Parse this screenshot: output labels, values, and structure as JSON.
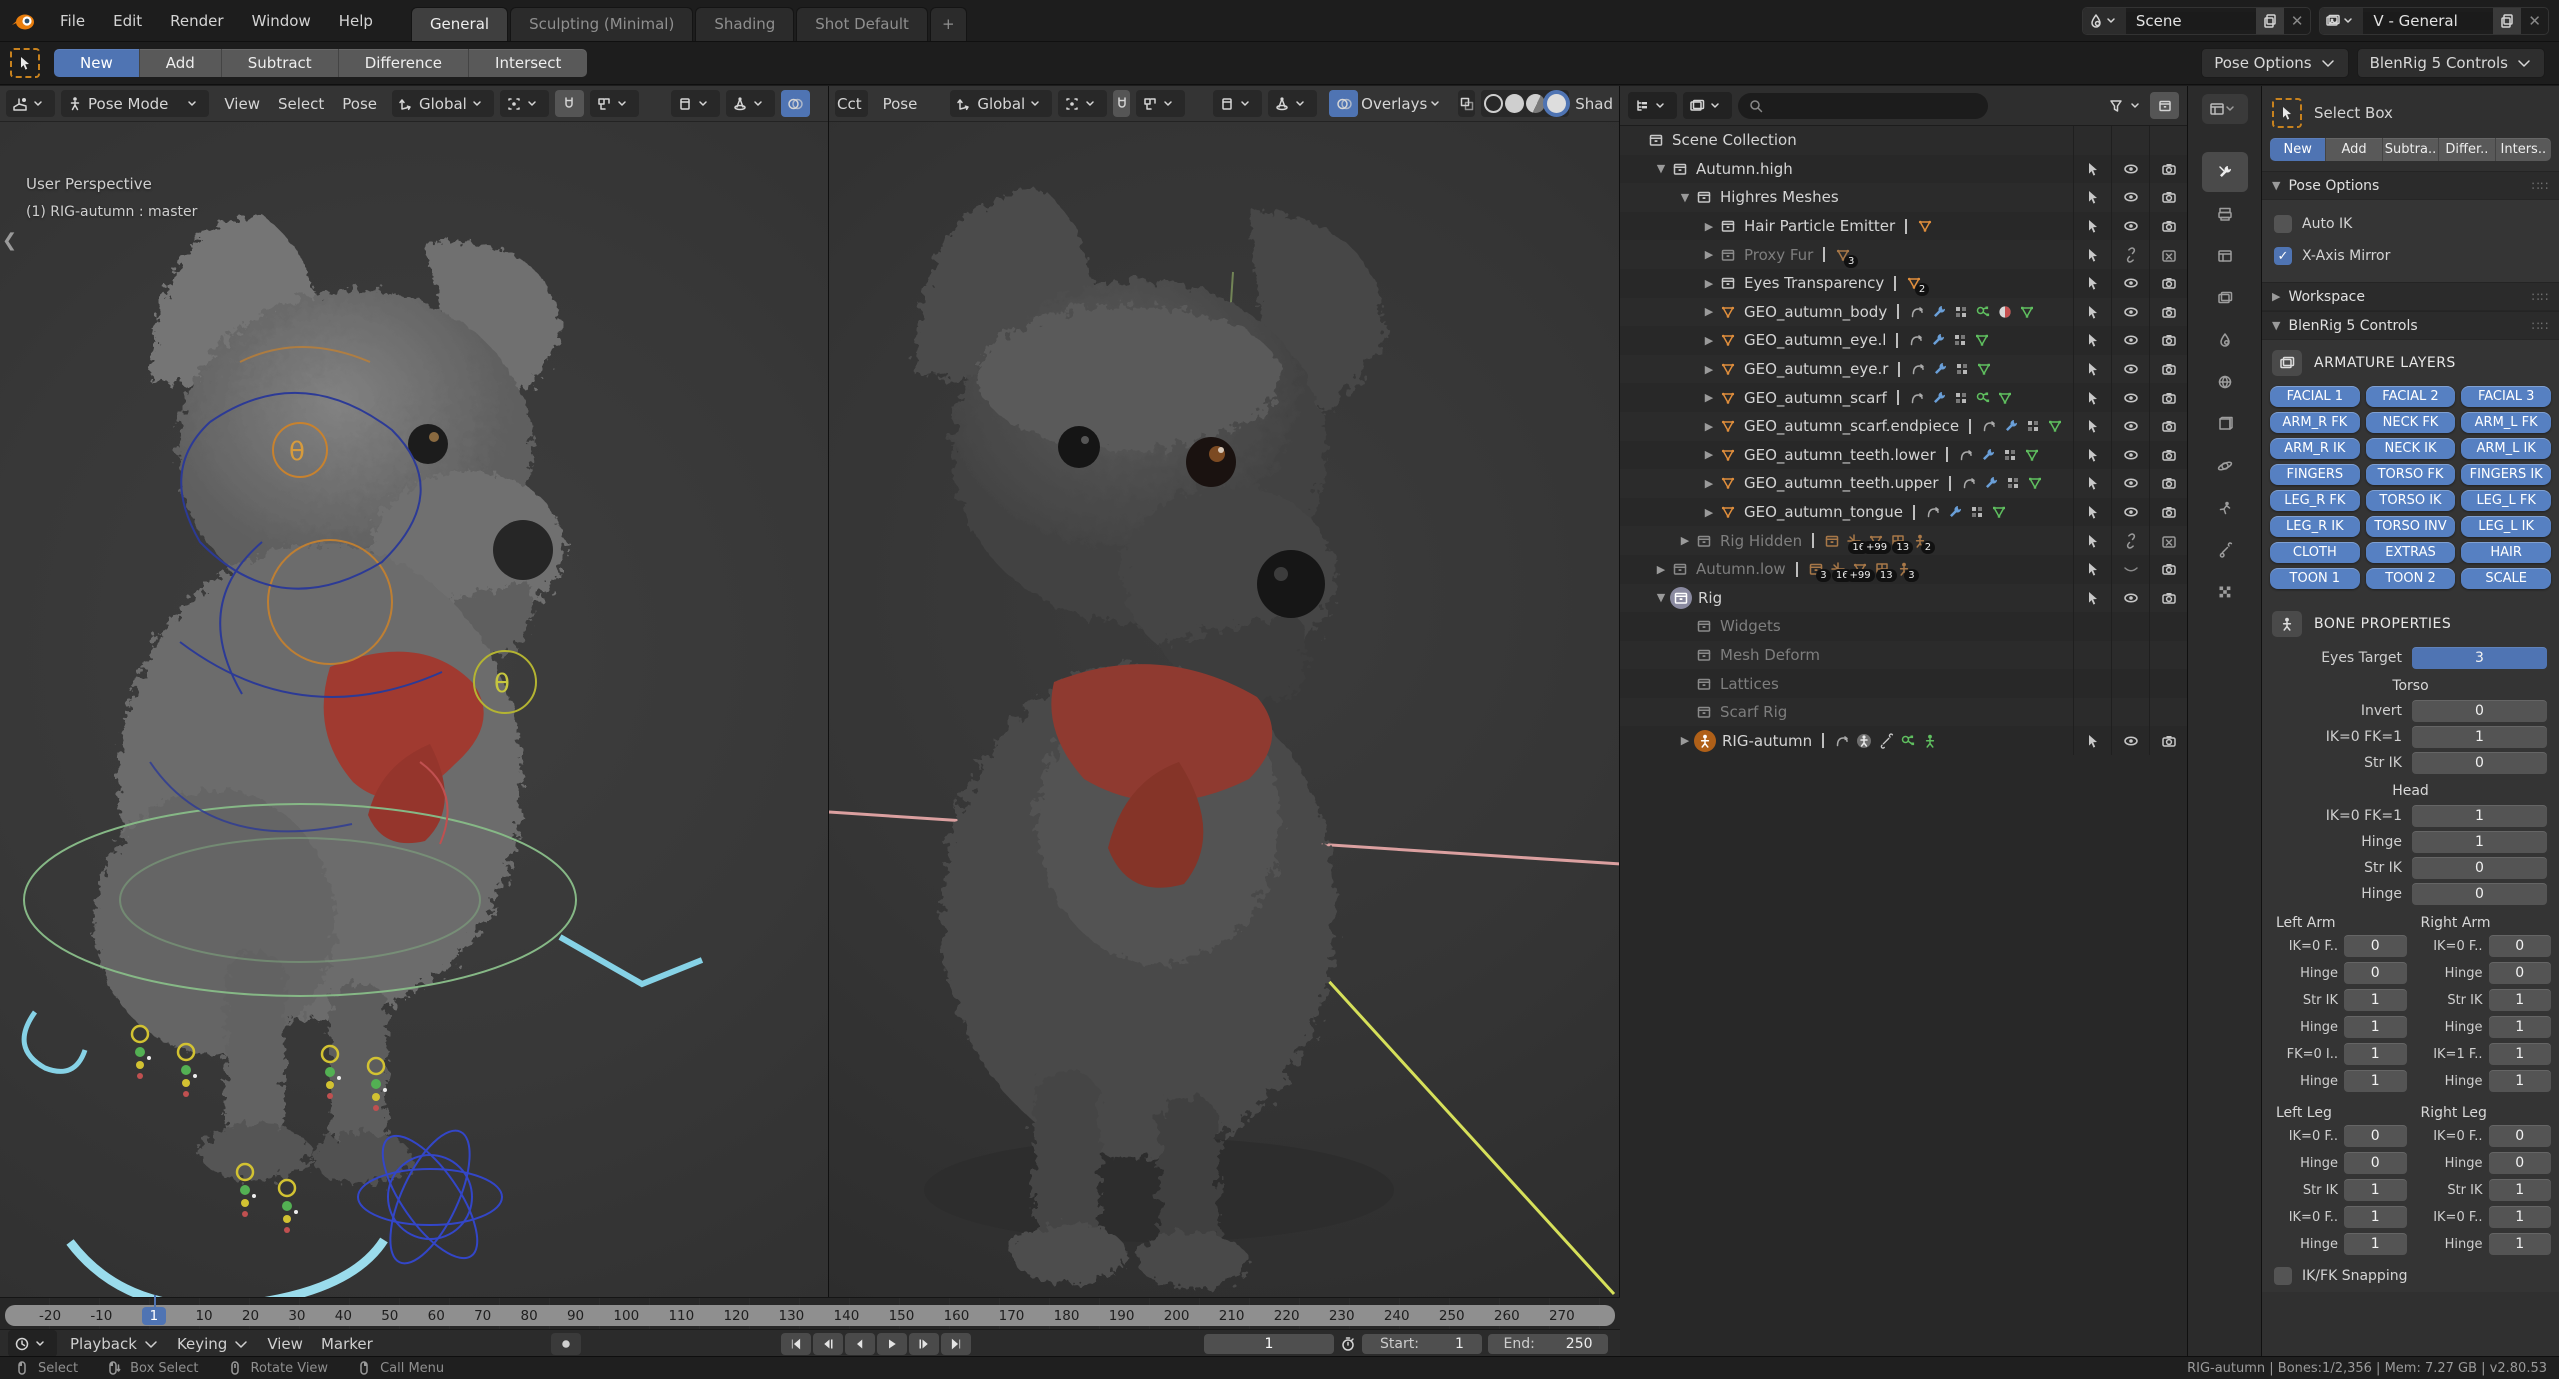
{
  "topbar": {
    "menus": [
      "File",
      "Edit",
      "Render",
      "Window",
      "Help"
    ],
    "tabs": [
      {
        "label": "General",
        "active": true
      },
      {
        "label": "Sculpting (Minimal)",
        "active": false
      },
      {
        "label": "Shading",
        "active": false
      },
      {
        "label": "Shot Default",
        "active": false
      }
    ],
    "new_tab": "+",
    "scene": {
      "label": "Scene"
    },
    "view_layer": {
      "label": "V - General"
    }
  },
  "toolbar": {
    "segments": [
      {
        "label": "New",
        "active": true
      },
      {
        "label": "Add",
        "active": false
      },
      {
        "label": "Subtract",
        "active": false
      },
      {
        "label": "Difference",
        "active": false
      },
      {
        "label": "Intersect",
        "active": false
      }
    ],
    "right_buttons": [
      "Pose Options",
      "BlenRig 5 Controls"
    ]
  },
  "viewport_left": {
    "mode": "Pose Mode",
    "menus": [
      "View",
      "Select",
      "Pose"
    ],
    "orientation": "Global",
    "overlay_line1": "User Perspective",
    "overlay_line2": "(1) RIG-autumn : master"
  },
  "viewport_right": {
    "mode_clipped": "Cct",
    "menus": [
      "Pose"
    ],
    "orientation": "Global",
    "overlays_label": "Overlays",
    "shading_clipped": "Shad"
  },
  "outliner": {
    "search_placeholder": "",
    "rows": [
      {
        "indent": 0,
        "exp": "",
        "icon": "collection",
        "label": "Scene Collection",
        "dim": false,
        "data": [],
        "counts": [],
        "toggles": "none"
      },
      {
        "indent": 1,
        "exp": "open",
        "icon": "collection",
        "label": "Autumn.high",
        "dim": false,
        "data": [],
        "counts": [],
        "toggles": "normal"
      },
      {
        "indent": 2,
        "exp": "open",
        "icon": "collection",
        "label": "Highres Meshes",
        "dim": false,
        "data": [],
        "counts": [],
        "toggles": "normal"
      },
      {
        "indent": 3,
        "exp": "closed",
        "icon": "collection",
        "label": "Hair Particle Emitter",
        "dim": false,
        "data": [
          "mesh"
        ],
        "counts": [],
        "toggles": "normal"
      },
      {
        "indent": 3,
        "exp": "closed",
        "icon": "collection",
        "label": "Proxy Fur",
        "dim": true,
        "data": [
          "mesh:3"
        ],
        "counts": [],
        "toggles": "hidden"
      },
      {
        "indent": 3,
        "exp": "closed",
        "icon": "collection",
        "label": "Eyes Transparency",
        "dim": false,
        "data": [
          "mesh:2"
        ],
        "counts": [],
        "toggles": "normal"
      },
      {
        "indent": 3,
        "exp": "closed",
        "icon": "mesh",
        "label": "GEO_autumn_body",
        "dim": false,
        "data": [
          "hook",
          "wrench",
          "dupli",
          "particles",
          "material",
          "meshdata"
        ],
        "counts": [],
        "toggles": "normal"
      },
      {
        "indent": 3,
        "exp": "closed",
        "icon": "mesh",
        "label": "GEO_autumn_eye.l",
        "dim": false,
        "data": [
          "hook",
          "wrench",
          "dupli",
          "meshdata"
        ],
        "counts": [],
        "toggles": "normal"
      },
      {
        "indent": 3,
        "exp": "closed",
        "icon": "mesh",
        "label": "GEO_autumn_eye.r",
        "dim": false,
        "data": [
          "hook",
          "wrench",
          "dupli",
          "meshdata"
        ],
        "counts": [],
        "toggles": "normal"
      },
      {
        "indent": 3,
        "exp": "closed",
        "icon": "mesh",
        "label": "GEO_autumn_scarf",
        "dim": false,
        "data": [
          "hook",
          "wrench",
          "dupli",
          "particles",
          "meshdata"
        ],
        "counts": [],
        "toggles": "normal"
      },
      {
        "indent": 3,
        "exp": "closed",
        "icon": "mesh",
        "label": "GEO_autumn_scarf.endpiece",
        "dim": false,
        "data": [
          "hook",
          "wrench",
          "dupli",
          "meshdata"
        ],
        "counts": [],
        "toggles": "normal"
      },
      {
        "indent": 3,
        "exp": "closed",
        "icon": "mesh",
        "label": "GEO_autumn_teeth.lower",
        "dim": false,
        "data": [
          "hook",
          "wrench",
          "dupli",
          "meshdata"
        ],
        "counts": [],
        "toggles": "normal"
      },
      {
        "indent": 3,
        "exp": "closed",
        "icon": "mesh",
        "label": "GEO_autumn_teeth.upper",
        "dim": false,
        "data": [
          "hook",
          "wrench",
          "dupli",
          "meshdata"
        ],
        "counts": [],
        "toggles": "normal"
      },
      {
        "indent": 3,
        "exp": "closed",
        "icon": "mesh",
        "label": "GEO_autumn_tongue",
        "dim": false,
        "data": [
          "hook",
          "wrench",
          "dupli",
          "meshdata"
        ],
        "counts": [],
        "toggles": "normal"
      },
      {
        "indent": 2,
        "exp": "closed",
        "icon": "collection",
        "label": "Rig Hidden",
        "dim": true,
        "data": [
          "collection",
          "empty:16",
          "mesh:+99",
          "lattice:13",
          "armature:2"
        ],
        "counts": [],
        "toggles": "hidden"
      },
      {
        "indent": 1,
        "exp": "closed",
        "icon": "collection",
        "label": "Autumn.low",
        "dim": true,
        "data": [
          "collection:3",
          "empty:16",
          "mesh:+99",
          "lattice:13",
          "armature:3"
        ],
        "counts": [],
        "toggles": "loweye"
      },
      {
        "indent": 1,
        "exp": "open",
        "icon": "collection-active",
        "label": "Rig",
        "dim": false,
        "data": [],
        "counts": [],
        "toggles": "normal"
      },
      {
        "indent": 2,
        "exp": "",
        "icon": "collection",
        "label": "Widgets",
        "dim": true,
        "data": [],
        "counts": [],
        "toggles": "none"
      },
      {
        "indent": 2,
        "exp": "",
        "icon": "collection",
        "label": "Mesh Deform",
        "dim": true,
        "data": [],
        "counts": [],
        "toggles": "none"
      },
      {
        "indent": 2,
        "exp": "",
        "icon": "collection",
        "label": "Lattices",
        "dim": true,
        "data": [],
        "counts": [],
        "toggles": "none"
      },
      {
        "indent": 2,
        "exp": "",
        "icon": "collection",
        "label": "Scarf Rig",
        "dim": true,
        "data": [],
        "counts": [],
        "toggles": "none"
      },
      {
        "indent": 2,
        "exp": "closed",
        "icon": "armature-active",
        "label": "RIG-autumn",
        "dim": false,
        "data": [
          "hook",
          "posecircle",
          "bonewrench",
          "particlesgreen",
          "armaturegreen"
        ],
        "counts": [],
        "toggles": "normal"
      }
    ]
  },
  "tabstrip": {
    "icons": [
      "tool",
      "render",
      "output",
      "view-layer",
      "scene",
      "world",
      "object",
      "physics",
      "pose",
      "bone",
      "texture"
    ]
  },
  "properties": {
    "tool_name": "Select Box",
    "segments": [
      {
        "label": "New",
        "active": true
      },
      {
        "label": "Add",
        "active": false
      },
      {
        "label": "Subtra..",
        "active": false
      },
      {
        "label": "Differ..",
        "active": false
      },
      {
        "label": "Inters..",
        "active": false
      }
    ],
    "panels": {
      "pose_options": {
        "title": "Pose Options",
        "items": [
          {
            "label": "Auto IK",
            "checked": false
          },
          {
            "label": "X-Axis Mirror",
            "checked": true
          }
        ]
      },
      "workspace": {
        "title": "Workspace"
      },
      "blenrig": {
        "title": "BlenRig 5 Controls"
      }
    },
    "armature_layers": {
      "title": "ARMATURE LAYERS",
      "buttons": [
        "FACIAL 1",
        "FACIAL 2",
        "FACIAL 3",
        "ARM_R FK",
        "NECK FK",
        "ARM_L FK",
        "ARM_R IK",
        "NECK IK",
        "ARM_L IK",
        "FINGERS",
        "TORSO FK",
        "FINGERS IK",
        "LEG_R FK",
        "TORSO IK",
        "LEG_L FK",
        "LEG_R IK",
        "TORSO INV",
        "LEG_L IK",
        "CLOTH",
        "EXTRAS",
        "HAIR",
        "TOON 1",
        "TOON 2",
        "SCALE"
      ]
    },
    "bone_properties": {
      "title": "BONE PROPERTIES",
      "eyes_target": {
        "label": "Eyes Target",
        "value": "3"
      },
      "groups": [
        {
          "title": "Torso",
          "rows": [
            [
              "Invert",
              "0"
            ],
            [
              "IK=0 FK=1",
              "1"
            ],
            [
              "Str IK",
              "0"
            ]
          ]
        },
        {
          "title": "Head",
          "rows": [
            [
              "IK=0 FK=1",
              "1"
            ],
            [
              "Hinge",
              "1"
            ],
            [
              "Str IK",
              "0"
            ],
            [
              "Hinge",
              "0"
            ]
          ]
        }
      ],
      "pairs": [
        {
          "left": {
            "title": "Left Arm",
            "rows": [
              [
                "IK=0 F..",
                "0"
              ],
              [
                "Hinge",
                "0"
              ],
              [
                "Str IK",
                "1"
              ],
              [
                "Hinge",
                "1"
              ],
              [
                "FK=0 I..",
                "1"
              ],
              [
                "Hinge",
                "1"
              ]
            ]
          },
          "right": {
            "title": "Right Arm",
            "rows": [
              [
                "IK=0 F..",
                "0"
              ],
              [
                "Hinge",
                "0"
              ],
              [
                "Str IK",
                "1"
              ],
              [
                "Hinge",
                "1"
              ],
              [
                "IK=1 F..",
                "1"
              ],
              [
                "Hinge",
                "1"
              ]
            ]
          }
        },
        {
          "left": {
            "title": "Left Leg",
            "rows": [
              [
                "IK=0 F..",
                "0"
              ],
              [
                "Hinge",
                "0"
              ],
              [
                "Str IK",
                "1"
              ],
              [
                "IK=0 F..",
                "1"
              ],
              [
                "Hinge",
                "1"
              ]
            ]
          },
          "right": {
            "title": "Right Leg",
            "rows": [
              [
                "IK=0 F..",
                "0"
              ],
              [
                "Hinge",
                "0"
              ],
              [
                "Str IK",
                "1"
              ],
              [
                "IK=0 F..",
                "1"
              ],
              [
                "Hinge",
                "1"
              ]
            ]
          }
        }
      ],
      "snapping": {
        "label": "IK/FK Snapping",
        "checked": false
      }
    }
  },
  "timeline": {
    "ticks": [
      "-20",
      "-10",
      "1",
      "10",
      "20",
      "30",
      "40",
      "50",
      "60",
      "70",
      "80",
      "90",
      "100",
      "110",
      "120",
      "130",
      "140",
      "150",
      "160",
      "170",
      "180",
      "190",
      "200",
      "210",
      "220",
      "230",
      "240",
      "250",
      "260",
      "270"
    ],
    "current_frame": "1",
    "menus": [
      "Playback",
      "Keying",
      "View",
      "Marker"
    ],
    "transport": [
      "jump-start",
      "prev-keyframe",
      "prev-frame",
      "play",
      "next-keyframe",
      "jump-end"
    ],
    "frame_field": "1",
    "start_label": "Start:",
    "start_value": "1",
    "end_label": "End:",
    "end_value": "250"
  },
  "statusbar": {
    "items": [
      {
        "icon": "mouse-left",
        "label": "Select"
      },
      {
        "icon": "mouse-left-drag",
        "label": "Box Select"
      },
      {
        "icon": "mouse-middle",
        "label": "Rotate View"
      },
      {
        "icon": "mouse-right",
        "label": "Call Menu"
      }
    ],
    "right": "RIG-autumn | Bones:1/2,356 | Mem: 7.27 GB | v2.80.53"
  },
  "colors": {
    "accent": "#4f74b3",
    "mesh_orange": "#e08e3c",
    "data_green": "#5fbf5f",
    "modifier_blue": "#6a9fd8",
    "scarf_red": "#9c4038"
  }
}
